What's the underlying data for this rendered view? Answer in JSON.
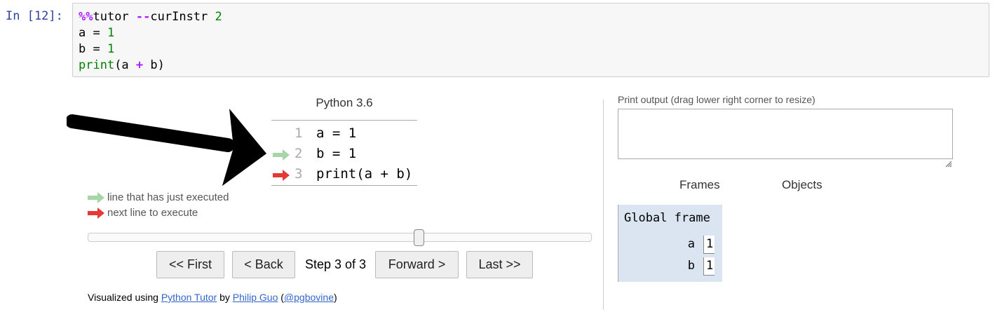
{
  "cell": {
    "prompt": "In [12]:",
    "lines": [
      {
        "parts": [
          "%%",
          "tutor ",
          "--",
          "curInstr ",
          "2"
        ]
      },
      {
        "text": "a = 1"
      },
      {
        "text": "b = 1"
      },
      {
        "text": "print(a + b)"
      }
    ]
  },
  "visualizer": {
    "title": "Python 3.6",
    "code_lines": [
      {
        "no": "1",
        "src": "a = 1",
        "arrow": "none"
      },
      {
        "no": "2",
        "src": "b = 1",
        "arrow": "just-executed"
      },
      {
        "no": "3",
        "src": "print(a + b)",
        "arrow": "next-to-execute"
      }
    ],
    "legend": {
      "just_executed": "line that has just executed",
      "next_line": "next line to execute"
    },
    "slider": {
      "value_fraction": 0.66
    },
    "buttons": {
      "first": "<< First",
      "back": "< Back",
      "forward": "Forward >",
      "last": "Last >>"
    },
    "step_label": "Step 3 of 3",
    "footer": {
      "prefix": "Visualized using ",
      "tool_link": "Python Tutor",
      "by": " by ",
      "author_link": "Philip Guo",
      "paren_open": " (",
      "handle_link": "@pgbovine",
      "paren_close": ")"
    }
  },
  "output_panel": {
    "print_label": "Print output (drag lower right corner to resize)",
    "print_value": "",
    "frames_header": "Frames",
    "objects_header": "Objects",
    "frame": {
      "title": "Global frame",
      "vars": [
        {
          "name": "a",
          "value": "1"
        },
        {
          "name": "b",
          "value": "1"
        }
      ]
    }
  },
  "colors": {
    "prompt": "#303f9f",
    "just_executed_arrow": "#a8d5a8",
    "next_arrow": "#e53935",
    "frame_bg": "#dbe5f1",
    "link": "#3366cc"
  }
}
